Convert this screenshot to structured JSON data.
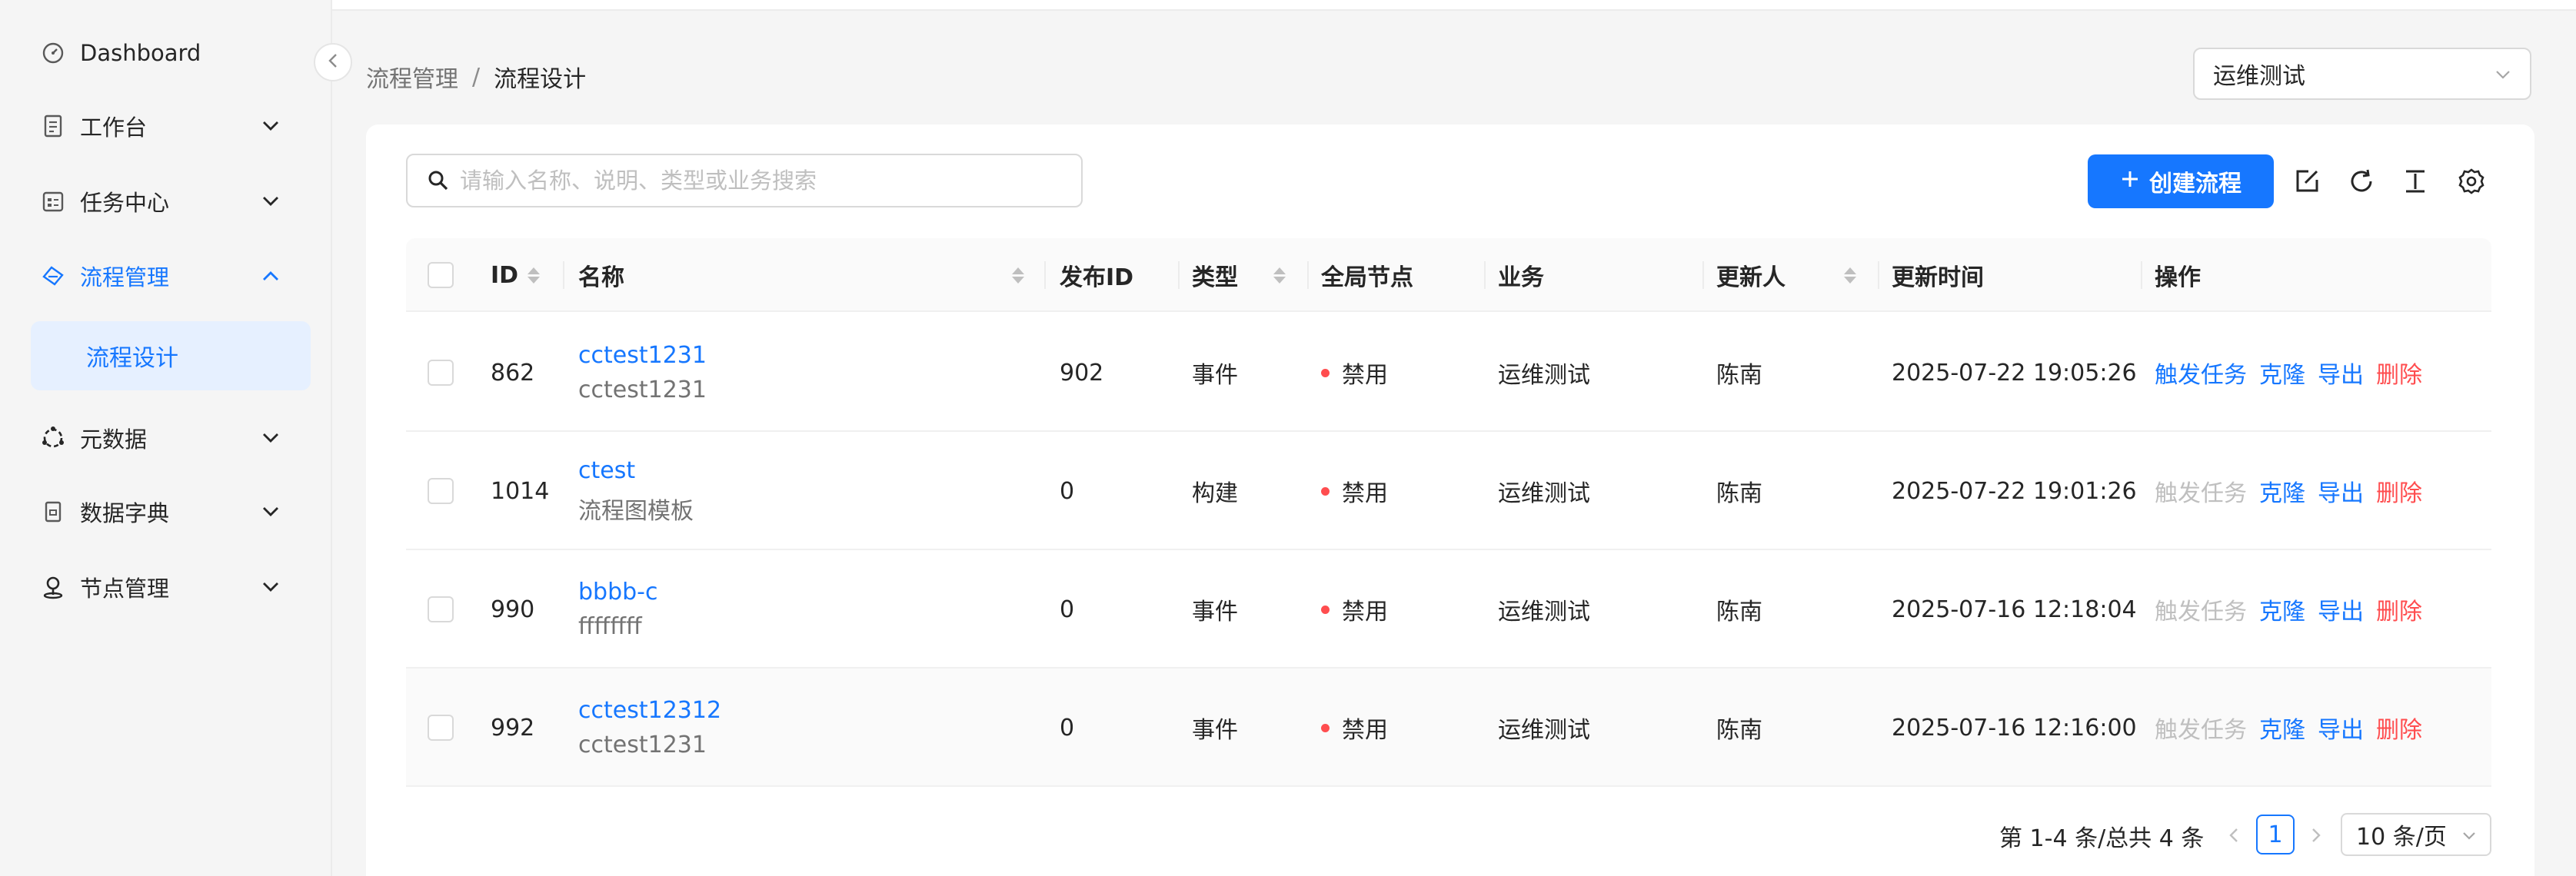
{
  "sidebar": {
    "items": [
      {
        "label": "Dashboard",
        "icon": "dashboard-icon"
      },
      {
        "label": "工作台",
        "icon": "document-icon"
      },
      {
        "label": "任务中心",
        "icon": "calendar-icon"
      },
      {
        "label": "流程管理",
        "icon": "flow-icon"
      },
      {
        "label": "元数据",
        "icon": "metadata-icon"
      },
      {
        "label": "数据字典",
        "icon": "dictionary-icon"
      },
      {
        "label": "节点管理",
        "icon": "location-icon"
      }
    ],
    "sub_item": "流程设计"
  },
  "breadcrumb": {
    "parent": "流程管理",
    "separator": "/",
    "current": "流程设计"
  },
  "business_select": {
    "value": "运维测试"
  },
  "toolbar": {
    "search_placeholder": "请输入名称、说明、类型或业务搜索",
    "create_label": "创建流程"
  },
  "table": {
    "columns": [
      "ID",
      "名称",
      "发布ID",
      "类型",
      "全局节点",
      "业务",
      "更新人",
      "更新时间",
      "操作"
    ],
    "rows": [
      {
        "id": "862",
        "name": "cctest1231",
        "desc": "cctest1231",
        "publish_id": "902",
        "type": "事件",
        "global": "禁用",
        "business": "运维测试",
        "updater": "陈南",
        "updated": "2025-07-22 19:05:26",
        "trigger_enabled": true
      },
      {
        "id": "1014",
        "name": "ctest",
        "desc": "流程图模板",
        "publish_id": "0",
        "type": "构建",
        "global": "禁用",
        "business": "运维测试",
        "updater": "陈南",
        "updated": "2025-07-22 19:01:26",
        "trigger_enabled": false
      },
      {
        "id": "990",
        "name": "bbbb-c",
        "desc": "ffffffff",
        "publish_id": "0",
        "type": "事件",
        "global": "禁用",
        "business": "运维测试",
        "updater": "陈南",
        "updated": "2025-07-16 12:18:04",
        "trigger_enabled": false
      },
      {
        "id": "992",
        "name": "cctest12312",
        "desc": "cctest1231",
        "publish_id": "0",
        "type": "事件",
        "global": "禁用",
        "business": "运维测试",
        "updater": "陈南",
        "updated": "2025-07-16 12:16:00",
        "trigger_enabled": false
      }
    ],
    "actions": {
      "trigger": "触发任务",
      "clone": "克隆",
      "export": "导出",
      "delete": "删除"
    }
  },
  "pagination": {
    "total_text": "第 1-4 条/总共 4 条",
    "current_page": "1",
    "page_size": "10 条/页"
  },
  "colors": {
    "primary": "#1677ff",
    "danger": "#ff4d4f",
    "disabled": "#bfbfbf"
  }
}
